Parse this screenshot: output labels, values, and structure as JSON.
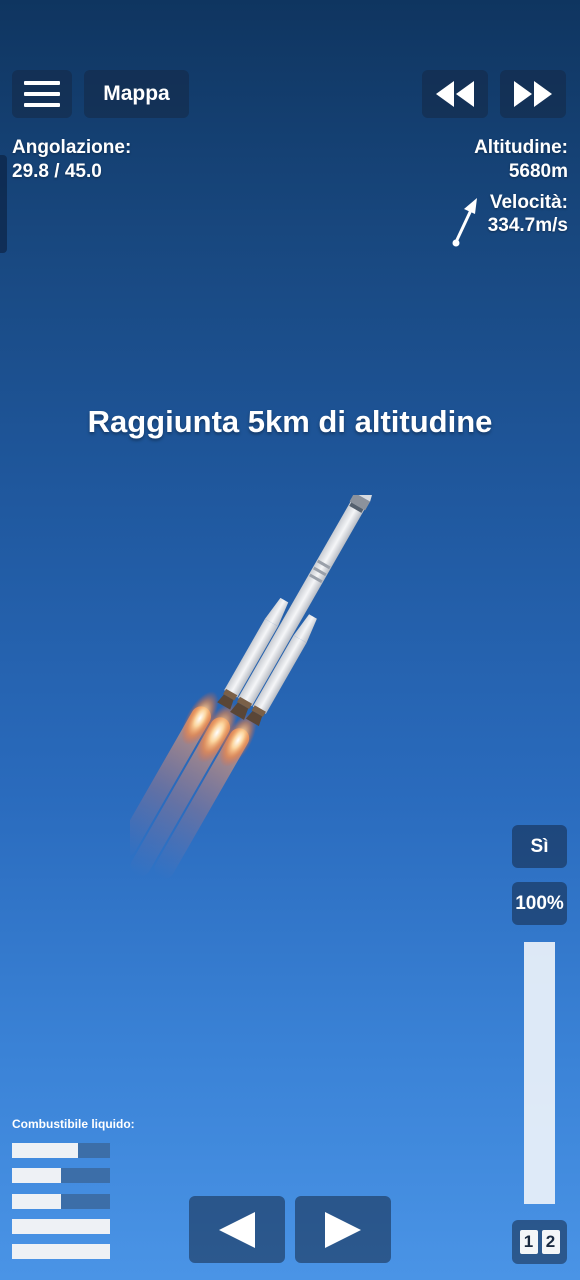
{
  "top_bar": {
    "menu_icon": "hamburger-icon",
    "map_label": "Mappa",
    "rewind_icon": "rewind-icon",
    "fast_forward_icon": "fast-forward-icon"
  },
  "telemetry": {
    "angle_label": "Angolazione:",
    "angle_value": "29.8 / 45.0",
    "altitude_label": "Altitudine:",
    "altitude_value": "5680m",
    "velocity_label": "Velocità:",
    "velocity_value": "334.7m/s"
  },
  "milestone_message": "Raggiunta 5km di altitudine",
  "controls": {
    "confirm_label": "Sì",
    "throttle_label": "100%",
    "throttle_level": 1.0,
    "stage_numbers": [
      "1",
      "2"
    ]
  },
  "fuel": {
    "label": "Combustibile liquido:",
    "levels": [
      0.67,
      0.5,
      0.5,
      1.0,
      1.0
    ]
  },
  "navigation": {
    "left_icon": "left-triangle-icon",
    "right_icon": "right-triangle-icon"
  },
  "colors": {
    "sky_top": "#0f3560",
    "sky_bottom": "#4a94e6",
    "button_bg": "#142846",
    "fuel_empty": "#3c6ea8",
    "fuel_full": "#eef1f5"
  }
}
